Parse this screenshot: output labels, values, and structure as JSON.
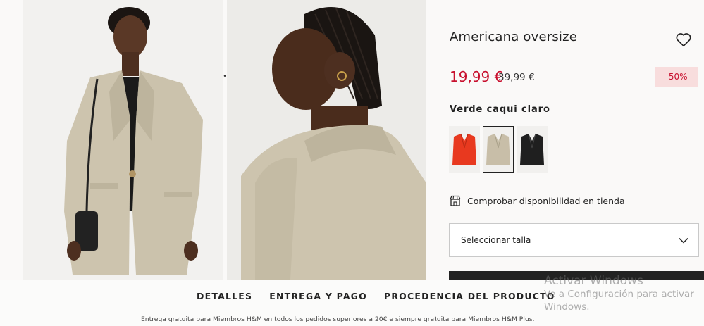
{
  "product": {
    "title": "Americana oversize",
    "price": "19,99 €",
    "old_price": "39,99 €",
    "discount": "-50%",
    "color_name": "Verde caqui claro",
    "swatches": [
      {
        "name": "rojo",
        "color": "#e8391f"
      },
      {
        "name": "verde caqui claro",
        "color": "#c8bea8",
        "selected": true
      },
      {
        "name": "negro",
        "color": "#1f1f1f"
      }
    ],
    "stock_check_label": "Comprobar disponibilidad en tienda",
    "size_select_label": "Seleccionar talla"
  },
  "gallery": {
    "separator_glyph": "•"
  },
  "tabs": [
    "DETALLES",
    "ENTREGA Y PAGO",
    "PROCEDENCIA DEL PRODUCTO"
  ],
  "footnote": "Entrega gratuita para Miembros H&M en todos los pedidos superiores a 20€ e siempre gratuita para Miembros H&M Plus.",
  "watermark": {
    "title": "Activar Windows",
    "line1": "Ve a Configuración para activar",
    "line2": "Windows."
  },
  "colors": {
    "sale": "#c8102e",
    "sale_bg": "#f8dddd",
    "text": "#222222",
    "jacket": "#cdc4ae"
  }
}
